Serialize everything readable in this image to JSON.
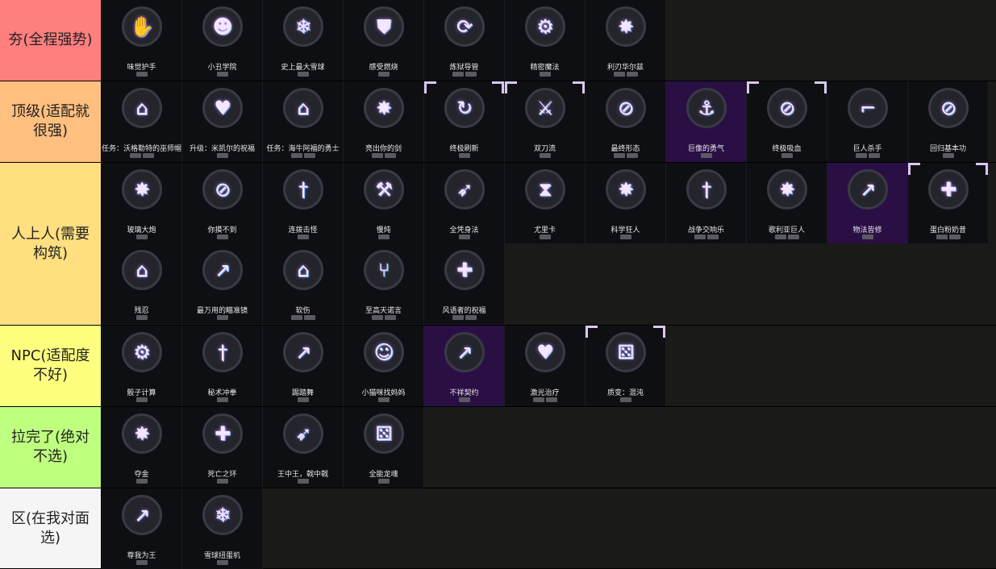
{
  "colors": {
    "tier_s": "#ff7f7f",
    "tier_a": "#ffbf7f",
    "tier_b": "#ffdf7f",
    "tier_c": "#ffff7f",
    "tier_d": "#bfff7f",
    "tier_e": "#f5f5f5"
  },
  "tiers": [
    {
      "label": "夯(全程强势)",
      "items": [
        {
          "name": "味觉护手",
          "icon": "hand-icon",
          "tags": 1
        },
        {
          "name": "小丑学院",
          "icon": "jester-mask-icon",
          "tags": 1
        },
        {
          "name": "史上最大雪球",
          "icon": "snowball-icon",
          "tags": 1
        },
        {
          "name": "感受燃烧",
          "icon": "shield-fire-icon",
          "tags": 1
        },
        {
          "name": "炼狱导管",
          "icon": "conduit-icon",
          "tags": 2
        },
        {
          "name": "精密魔法",
          "icon": "gear-orb-icon",
          "tags": 1
        },
        {
          "name": "利刃华尔兹",
          "icon": "starburst-icon",
          "tags": 2
        }
      ]
    },
    {
      "label": "顶级(适配就很强)",
      "items": [
        {
          "name": "任务：沃格勒特的巫师帽",
          "icon": "hat-icon",
          "tags": 2
        },
        {
          "name": "升级：米凯尔的祝福",
          "icon": "heart-plus-icon",
          "tags": 1
        },
        {
          "name": "任务：海牛阿福的勇士",
          "icon": "hat-icon",
          "tags": 2
        },
        {
          "name": "亮出你的剑",
          "icon": "starburst-icon",
          "tags": 2
        },
        {
          "name": "终极刷新",
          "icon": "refresh-slash-icon",
          "tags": 1,
          "frame": true
        },
        {
          "name": "双刀流",
          "icon": "swords-icon",
          "tags": 1,
          "frame": true
        },
        {
          "name": "最终形态",
          "icon": "slash-orb-icon",
          "tags": 2
        },
        {
          "name": "巨像的勇气",
          "icon": "anchor-icon",
          "tags": 1,
          "purple": true
        },
        {
          "name": "终极吸血",
          "icon": "slash-orb-icon",
          "tags": 1,
          "frame": true
        },
        {
          "name": "巨人杀手",
          "icon": "boot-icon",
          "tags": 2
        },
        {
          "name": "回归基本功",
          "icon": "slash-orb-icon",
          "tags": 1
        }
      ]
    },
    {
      "label": "人上人(需要构筑)",
      "items": [
        {
          "name": "玻璃大炮",
          "icon": "starburst-icon",
          "tags": 1
        },
        {
          "name": "你摸不到",
          "icon": "slash-orb-icon",
          "tags": 1
        },
        {
          "name": "连拨击怪",
          "icon": "sword-icon",
          "tags": 1
        },
        {
          "name": "慢炖",
          "icon": "axe-icon",
          "tags": 1
        },
        {
          "name": "全凭身法",
          "icon": "runner-icon",
          "tags": 1
        },
        {
          "name": "尤里卡",
          "icon": "hourglass-icon",
          "tags": 1
        },
        {
          "name": "科学狂人",
          "icon": "starburst-icon",
          "tags": 1
        },
        {
          "name": "战争交响乐",
          "icon": "sword-icon",
          "tags": 2
        },
        {
          "name": "歌利亚巨人",
          "icon": "starburst-icon",
          "tags": 2
        },
        {
          "name": "物法皆修",
          "icon": "arrow-up-icon",
          "tags": 1,
          "purple": true
        },
        {
          "name": "蛋白粉奶昔",
          "icon": "shield-plus-icon",
          "tags": 2,
          "frame": true
        },
        {
          "name": "残忍",
          "icon": "hat-icon",
          "tags": 1
        },
        {
          "name": "最万用的瞄准镜",
          "icon": "arrow-up-icon",
          "tags": 1
        },
        {
          "name": "软伤",
          "icon": "hat-icon",
          "tags": 2
        },
        {
          "name": "至高天诺言",
          "icon": "branch-icon",
          "tags": 2
        },
        {
          "name": "风语者的祝福",
          "icon": "shield-plus-icon",
          "tags": 2
        }
      ]
    },
    {
      "label": "NPC(适配度不好)",
      "items": [
        {
          "name": "骰子计算",
          "icon": "gear-arrow-icon",
          "tags": 1
        },
        {
          "name": "秘术冲拳",
          "icon": "sword-icon",
          "tags": 1
        },
        {
          "name": "踢踏舞",
          "icon": "arrow-up-icon",
          "tags": 1
        },
        {
          "name": "小猫咪找妈妈",
          "icon": "person-plus-icon",
          "tags": 1
        },
        {
          "name": "不祥契约",
          "icon": "arrow-up-icon",
          "tags": 1,
          "purple": true
        },
        {
          "name": "激光治疗",
          "icon": "heart-plus-icon",
          "tags": 2
        },
        {
          "name": "质变：混沌",
          "icon": "dice-icon",
          "tags": 1,
          "frame": true
        }
      ]
    },
    {
      "label": "拉完了(绝对不选)",
      "items": [
        {
          "name": "夺金",
          "icon": "starburst-icon",
          "tags": 1
        },
        {
          "name": "死亡之环",
          "icon": "shield-plus-icon",
          "tags": 1
        },
        {
          "name": "王中王，戟中戟",
          "icon": "runner-icon",
          "tags": 1
        },
        {
          "name": "全能龙魂",
          "icon": "dice-icon",
          "tags": 1
        }
      ]
    },
    {
      "label": "区(在我对面选)",
      "items": [
        {
          "name": "尊我为王",
          "icon": "arrow-up-icon",
          "tags": 1
        },
        {
          "name": "雪球扭蛋机",
          "icon": "snowball-icon",
          "tags": 1
        }
      ]
    }
  ]
}
